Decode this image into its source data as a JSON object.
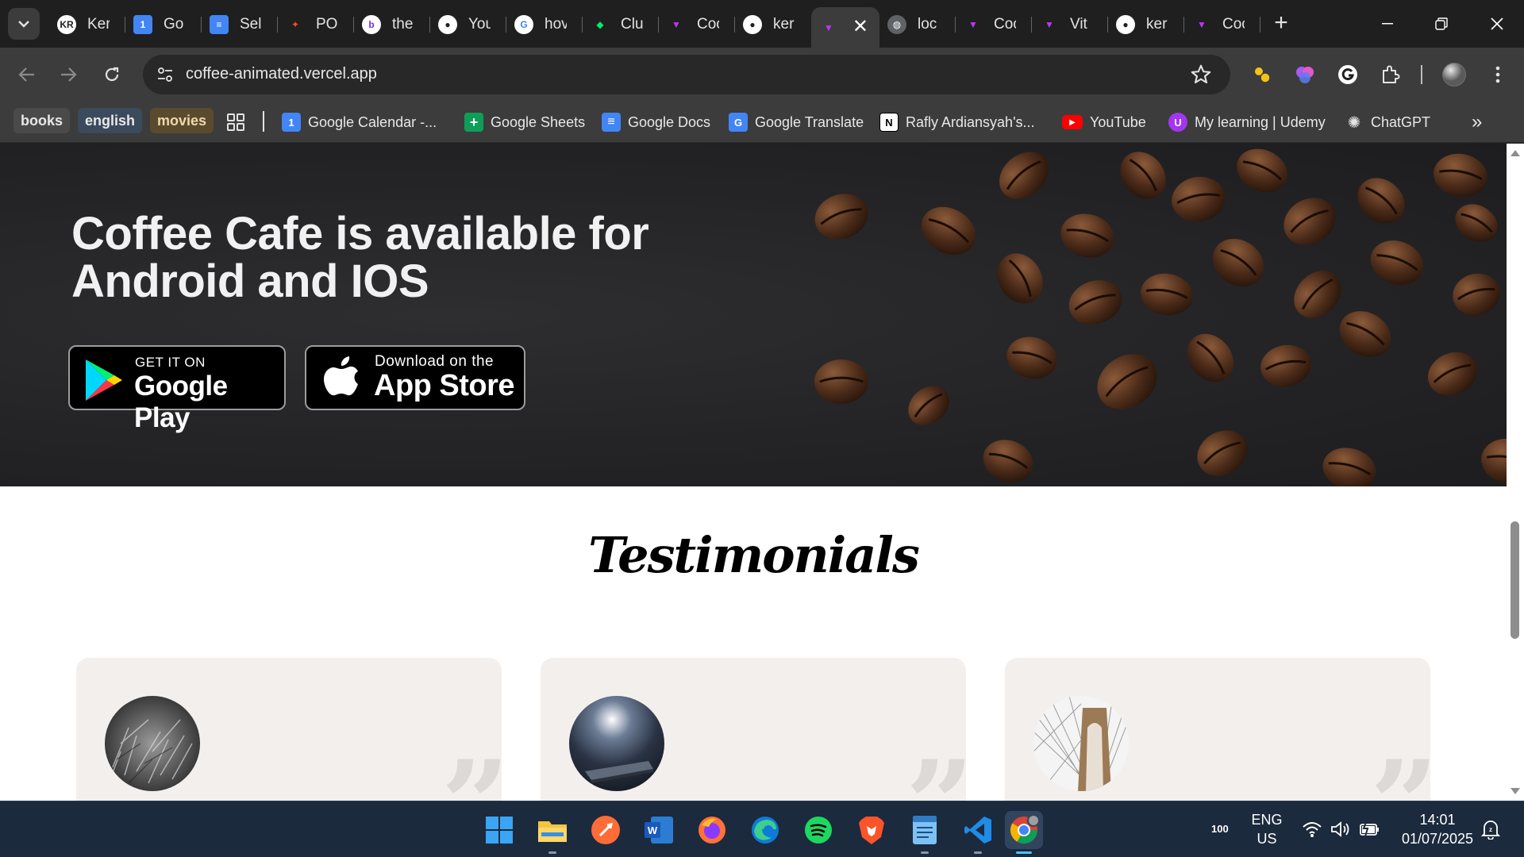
{
  "browser": {
    "tabs": [
      {
        "label": "Ker",
        "icon": "kr-avatar-icon",
        "badge": "KR"
      },
      {
        "label": "Go",
        "icon": "google-calendar-icon"
      },
      {
        "label": "Sel",
        "icon": "google-docs-icon"
      },
      {
        "label": "PO",
        "icon": "figma-icon"
      },
      {
        "label": "the",
        "icon": "b-logo-icon"
      },
      {
        "label": "You",
        "icon": "github-icon"
      },
      {
        "label": "hov",
        "icon": "google-icon"
      },
      {
        "label": "Clu",
        "icon": "mongodb-icon"
      },
      {
        "label": "Coo",
        "icon": "vite-icon"
      },
      {
        "label": "ker",
        "icon": "github-icon"
      },
      {
        "label": "",
        "icon": "vite-icon",
        "active": true
      },
      {
        "label": "loc",
        "icon": "globe-icon"
      },
      {
        "label": "Coo",
        "icon": "vite-icon"
      },
      {
        "label": "Vit",
        "icon": "vite-icon"
      },
      {
        "label": "ker",
        "icon": "github-icon"
      },
      {
        "label": "Coo",
        "icon": "vite-icon"
      }
    ],
    "url": "coffee-animated.vercel.app",
    "bookmark_chips": [
      {
        "label": "books",
        "bg": "#4a4a4a",
        "fg": "#e8e8e8"
      },
      {
        "label": "english",
        "bg": "#3b4a5c",
        "fg": "#e8e8e8"
      },
      {
        "label": "movies",
        "bg": "#5a4a2e",
        "fg": "#f0d9a8"
      }
    ],
    "bookmarks": [
      {
        "label": "Google Calendar -...",
        "icon": "google-calendar-icon"
      },
      {
        "label": "Google Sheets",
        "icon": "google-sheets-icon"
      },
      {
        "label": "Google Docs",
        "icon": "google-docs-icon"
      },
      {
        "label": "Google Translate",
        "icon": "google-translate-icon"
      },
      {
        "label": "Rafly Ardiansyah's...",
        "icon": "notion-icon"
      },
      {
        "label": "YouTube",
        "icon": "youtube-icon"
      },
      {
        "label": "My learning | Udemy",
        "icon": "udemy-icon"
      },
      {
        "label": "ChatGPT",
        "icon": "chatgpt-icon"
      }
    ]
  },
  "page": {
    "hero": {
      "title": "Coffee Cafe is available for Android and IOS",
      "google_play": {
        "small": "GET IT ON",
        "big": "Google Play"
      },
      "app_store": {
        "small": "Download on the",
        "big": "App Store"
      }
    },
    "testimonials": {
      "title": "Testimonials",
      "cards": [
        {
          "avatar": "grass-photo"
        },
        {
          "avatar": "phone-photo"
        },
        {
          "avatar": "bridge-photo"
        }
      ]
    }
  },
  "taskbar": {
    "apps": [
      "windows-start-icon",
      "file-explorer-icon",
      "postman-icon",
      "word-icon",
      "firefox-icon",
      "edge-icon",
      "spotify-icon",
      "brave-icon",
      "notepad-icon",
      "vscode-icon",
      "chrome-icon"
    ],
    "battery": "100",
    "lang_line1": "ENG",
    "lang_line2": "US",
    "time": "14:01",
    "date": "01/07/2025"
  },
  "colors": {
    "accent_blue": "#4cc2ff",
    "hero_bg": "#242426",
    "card_bg": "#f3efed"
  }
}
